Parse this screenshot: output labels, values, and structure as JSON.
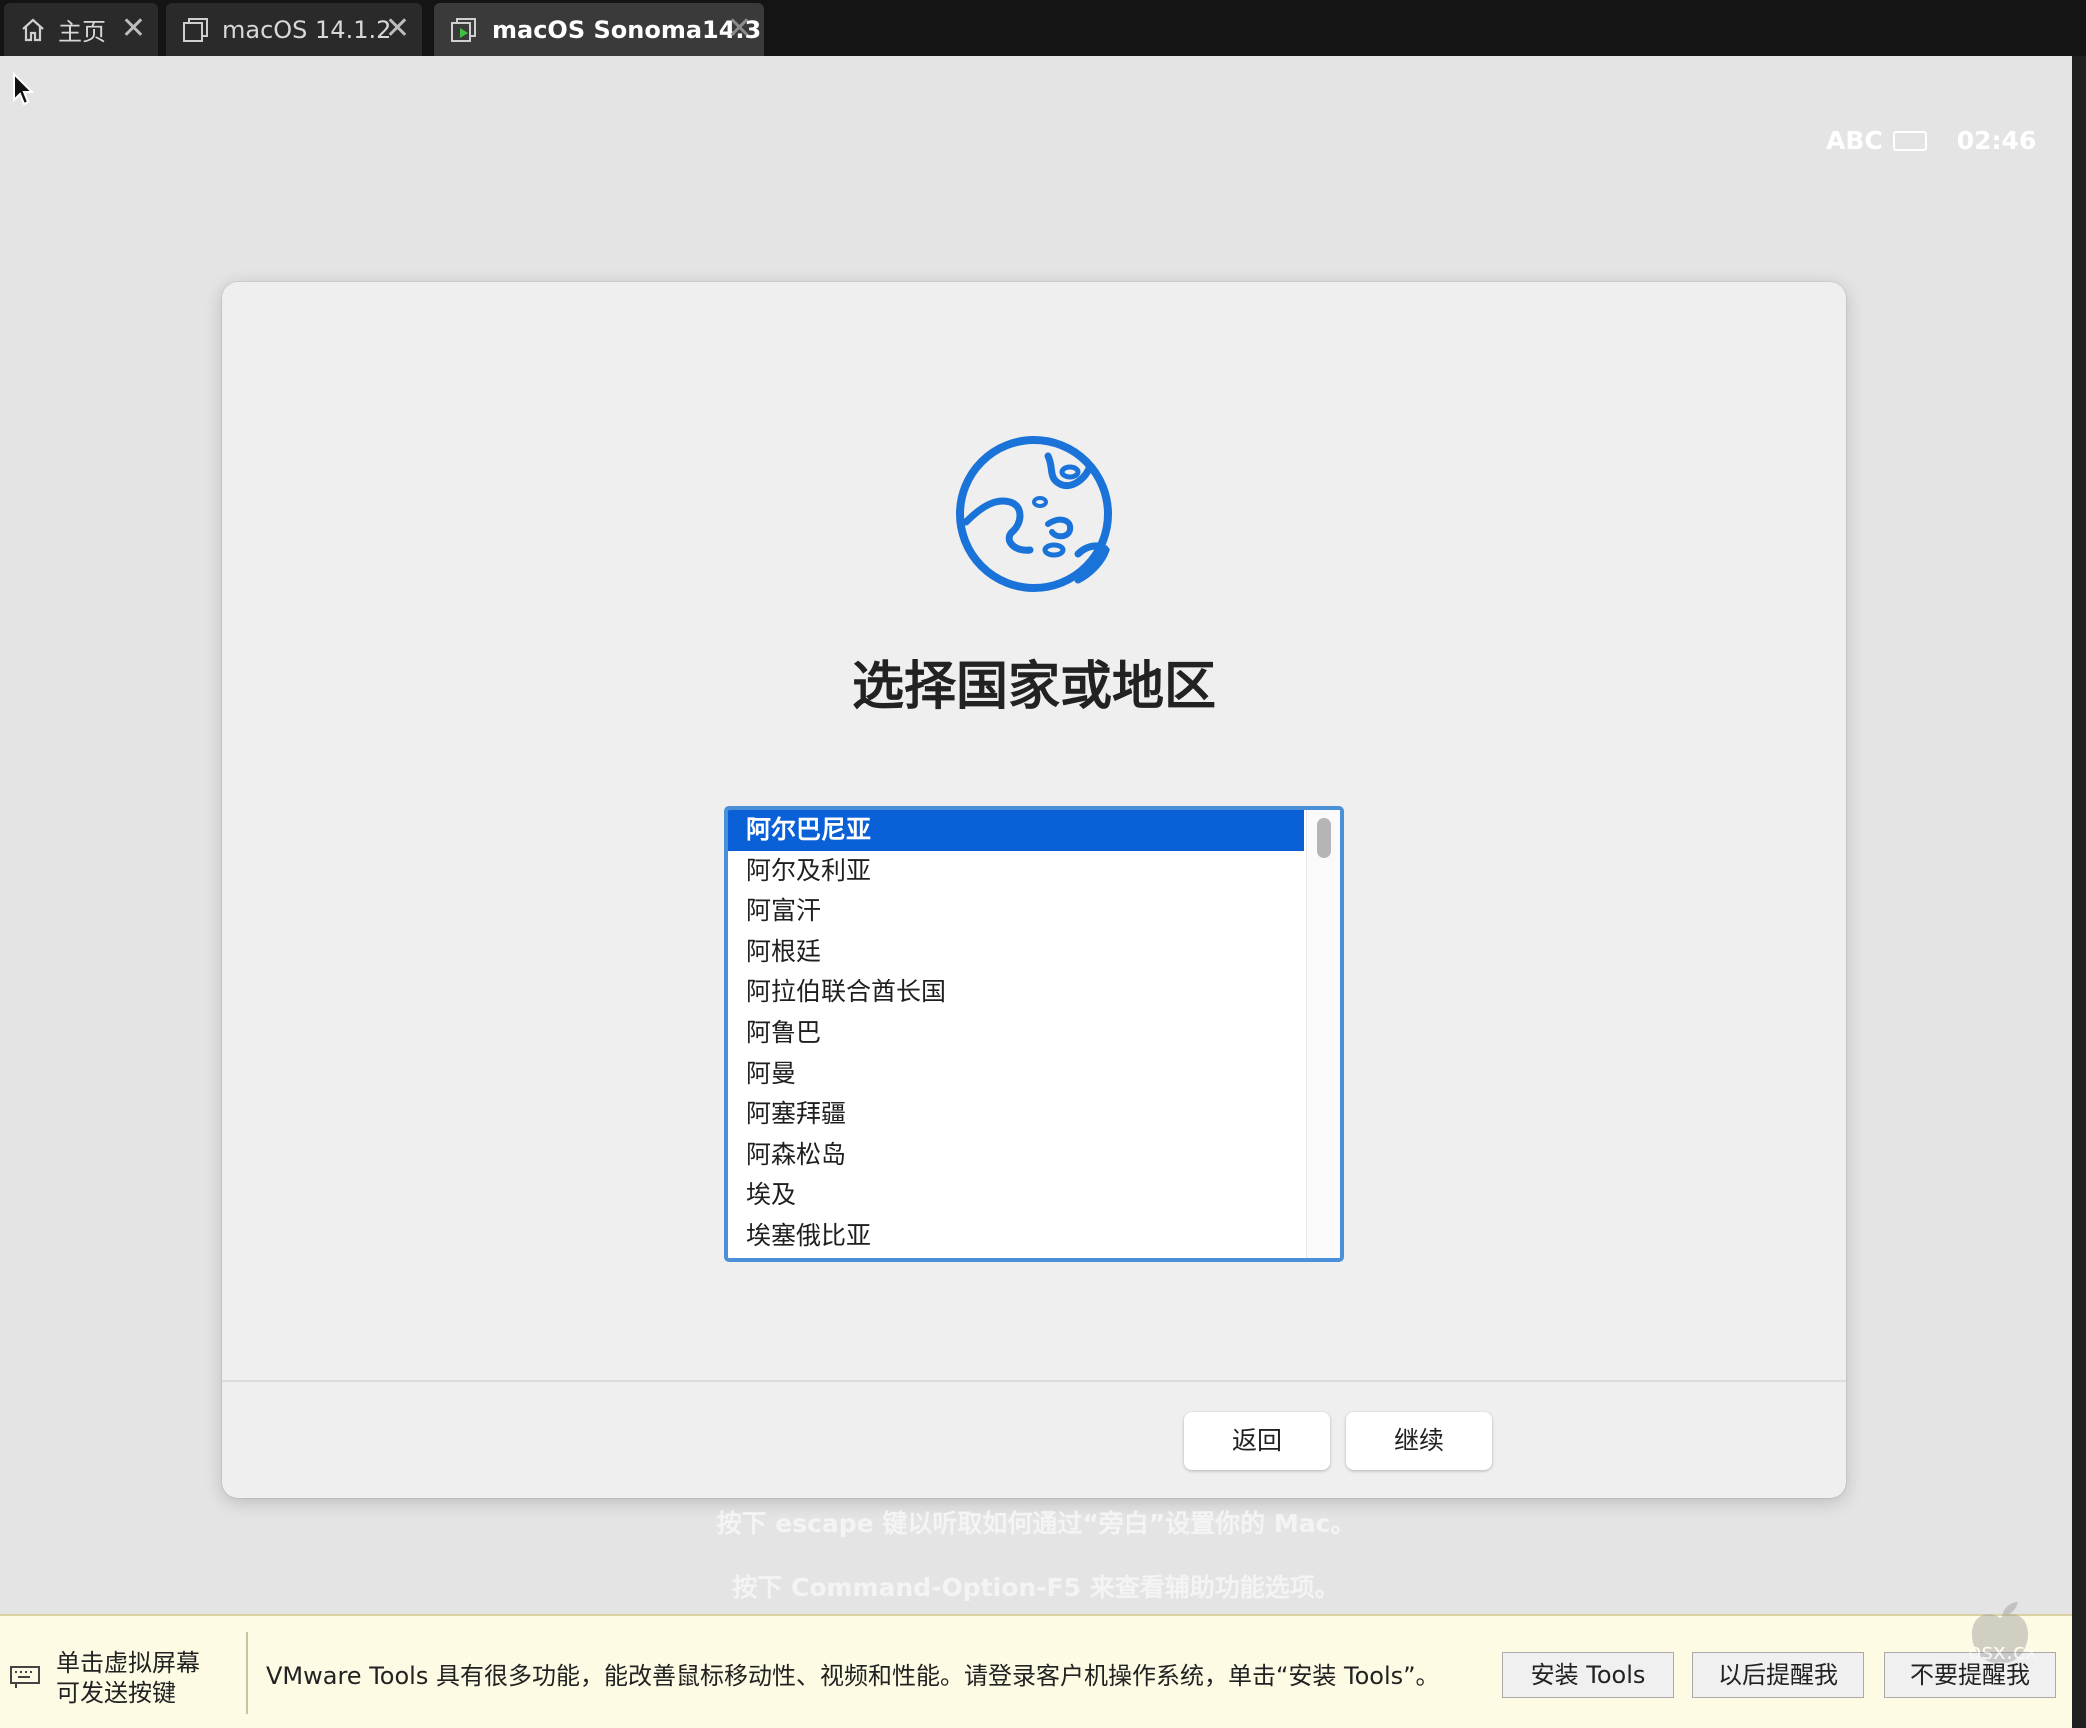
{
  "tabs": [
    {
      "label": "主页",
      "icon": "home-icon"
    },
    {
      "label": "macOS 14.1.2",
      "icon": "vm-icon"
    },
    {
      "label": "macOS Sonoma14.3",
      "icon": "vm-running-icon",
      "active": true
    }
  ],
  "menubar": {
    "input_source": "ABC",
    "time": "02:46"
  },
  "dialog": {
    "title": "选择国家或地区",
    "countries": [
      "阿尔巴尼亚",
      "阿尔及利亚",
      "阿富汗",
      "阿根廷",
      "阿拉伯联合酋长国",
      "阿鲁巴",
      "阿曼",
      "阿塞拜疆",
      "阿森松岛",
      "埃及",
      "埃塞俄比亚"
    ],
    "selected_index": 0,
    "back_label": "返回",
    "continue_label": "继续"
  },
  "hints": {
    "escape": "按下 escape 键以听取如何通过“旁白”设置你的 Mac。",
    "accessibility": "按下 Command-Option-F5 来查看辅助功能选项。"
  },
  "vmware_bar": {
    "send_keys_line1": "单击虚拟屏幕",
    "send_keys_line2": "可发送按键",
    "message": "VMware Tools 具有很多功能，能改善鼠标移动性、视频和性能。请登录客户机操作系统，单击“安装 Tools”。",
    "install_label": "安装 Tools",
    "remind_later_label": "以后提醒我",
    "dont_remind_label": "不要提醒我"
  },
  "watermark": "osx.cx",
  "colors": {
    "accent": "#0a60d6",
    "globe": "#1a73d9",
    "notify_bg": "#fdfbe4"
  }
}
